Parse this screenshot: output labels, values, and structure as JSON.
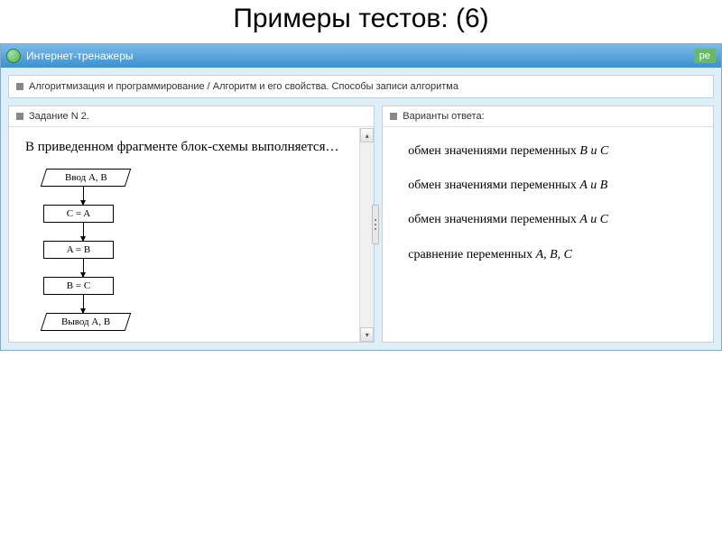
{
  "slide": {
    "title": "Примеры тестов: (6)"
  },
  "window": {
    "title": "Интернет-тренажеры",
    "right_badge": "ре"
  },
  "breadcrumb": "Алгоритмизация и программирование / Алгоритм и его свойства. Способы записи алгоритма",
  "task": {
    "header": "Задание N 2.",
    "question": "В приведенном фрагменте блок-схемы выполняется…",
    "flow": {
      "input": "Ввод A, B",
      "s1": "C = A",
      "s2": "A = B",
      "s3": "B = C",
      "output": "Вывод A, B"
    }
  },
  "answers": {
    "header": "Варианты ответа:",
    "items": [
      {
        "prefix": "обмен значениями переменных ",
        "vars": "B и C"
      },
      {
        "prefix": "обмен значениями переменных ",
        "vars": "A и B"
      },
      {
        "prefix": "обмен значениями переменных ",
        "vars": "A и C"
      },
      {
        "prefix": "сравнение переменных ",
        "vars": "A, B, C"
      }
    ]
  }
}
